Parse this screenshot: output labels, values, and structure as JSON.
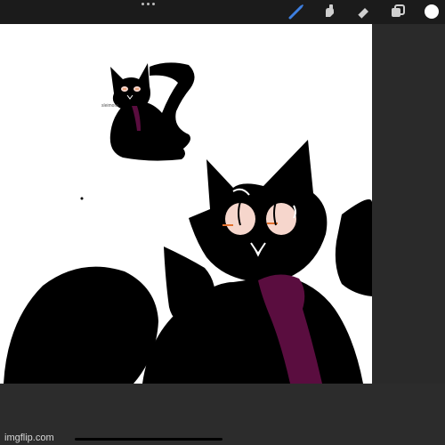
{
  "app": {
    "toolbar": {
      "tools": [
        {
          "name": "brush-tool",
          "icon": "brush-icon",
          "active": true
        },
        {
          "name": "smudge-tool",
          "icon": "smudge-icon",
          "active": false
        },
        {
          "name": "eraser-tool",
          "icon": "eraser-icon",
          "active": false
        },
        {
          "name": "layers-tool",
          "icon": "layers-icon",
          "active": false
        },
        {
          "name": "color-tool",
          "icon": "color-swatch-icon",
          "active": false
        }
      ],
      "menu_icon": "more-dots-icon"
    },
    "canvas": {
      "signature_text": "sleimora"
    },
    "watermark": "imgflip.com"
  },
  "colors": {
    "toolbar_bg": "#1b1b1b",
    "panel_bg": "#2a2a2a",
    "brush_active": "#3d7fe0",
    "swatch": "#ffffff",
    "cat_black": "#000000",
    "scarf_purple": "#5a0d3f",
    "cheek_pink": "#f6d6cc",
    "eye_orange": "#e2712e"
  }
}
